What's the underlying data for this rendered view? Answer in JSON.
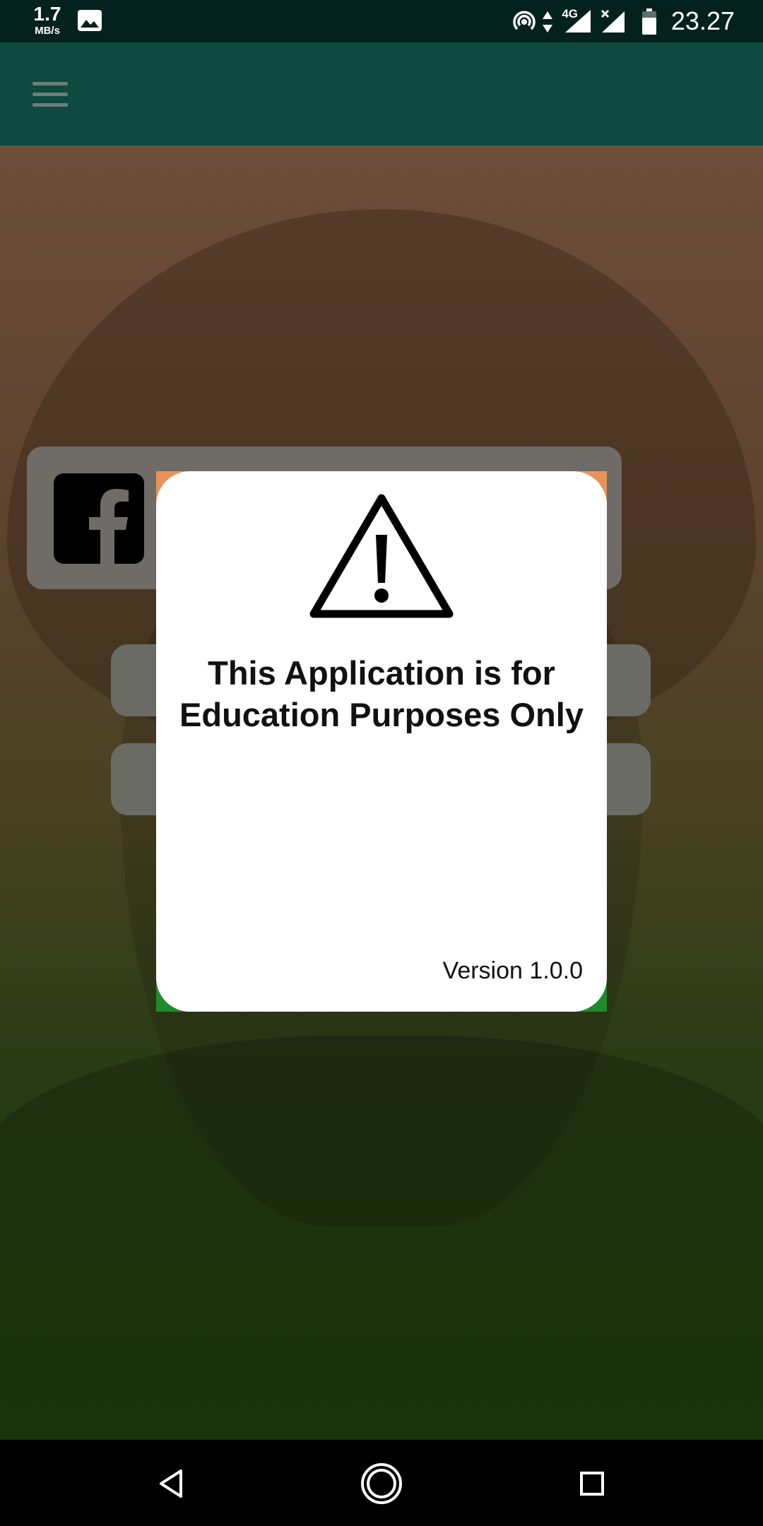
{
  "status_bar": {
    "speed_value": "1.7",
    "speed_unit": "MB/s",
    "notification_icon": "image-icon",
    "hotspot_icon": "hotspot-icon",
    "network_type": "4G",
    "signal_icon": "signal-icon",
    "battery_icon": "battery-icon",
    "time": "23.27"
  },
  "app_bar": {
    "menu_icon": "hamburger-menu-icon"
  },
  "background": {
    "social_icon": "facebook-icon",
    "help_icon": "head-question-icon"
  },
  "dialog": {
    "icon": "warning-icon",
    "message": "This Application is for Education Purposes Only",
    "version": "Version 1.0.0"
  },
  "nav_bar": {
    "back_icon": "back-triangle-icon",
    "home_icon": "home-circle-icon",
    "recents_icon": "recents-square-icon"
  },
  "colors": {
    "status_bar": "#04221d",
    "app_bar": "#0d4a3f",
    "dialog_background": "#ffffff",
    "accent_orange": "#e8935c",
    "accent_green": "#1f8a2a"
  }
}
